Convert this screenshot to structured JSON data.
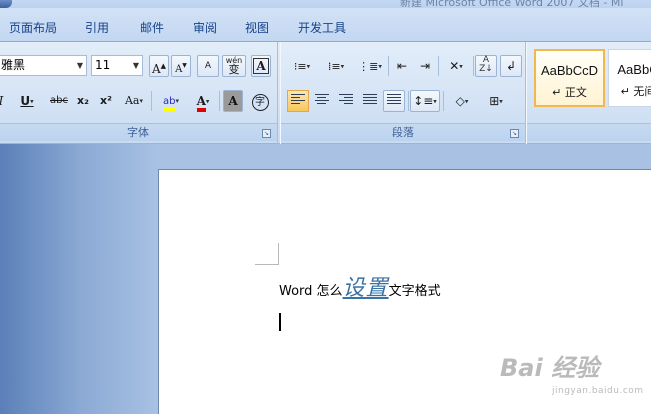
{
  "window": {
    "title": "新建 Microsoft Office Word 2007 文档 - Mi"
  },
  "tabs": [
    "页面布局",
    "引用",
    "邮件",
    "审阅",
    "视图",
    "开发工具"
  ],
  "font_group": {
    "label": "字体",
    "font_name": "雅黑",
    "font_size": "11",
    "grow_font": "A",
    "shrink_font": "A",
    "change_case": "Aa",
    "char_border": "A",
    "char_shading": "A",
    "enclose": "字",
    "phonetic": "wén",
    "phonetic_char": "变",
    "clear_format": "A",
    "italic": "I",
    "underline": "U",
    "strike": "abc",
    "subscript": "x₂",
    "superscript": "x²",
    "highlight": "ab",
    "font_color_glyph": "A",
    "highlight_color": "#ffff00",
    "font_color": "#e00000"
  },
  "paragraph_group": {
    "label": "段落"
  },
  "styles_group": {
    "styles": [
      {
        "sample": "AaBbCcD",
        "name": "正文",
        "glyph": "↵"
      },
      {
        "sample": "AaBbC",
        "name": "无间",
        "glyph": "↵"
      }
    ]
  },
  "document": {
    "line_prefix": "Word 怎么",
    "fancy_text": "设置",
    "line_suffix": "文字格式"
  },
  "watermark": {
    "main": "Bai 经验",
    "sub": "jingyan.baidu.com"
  }
}
